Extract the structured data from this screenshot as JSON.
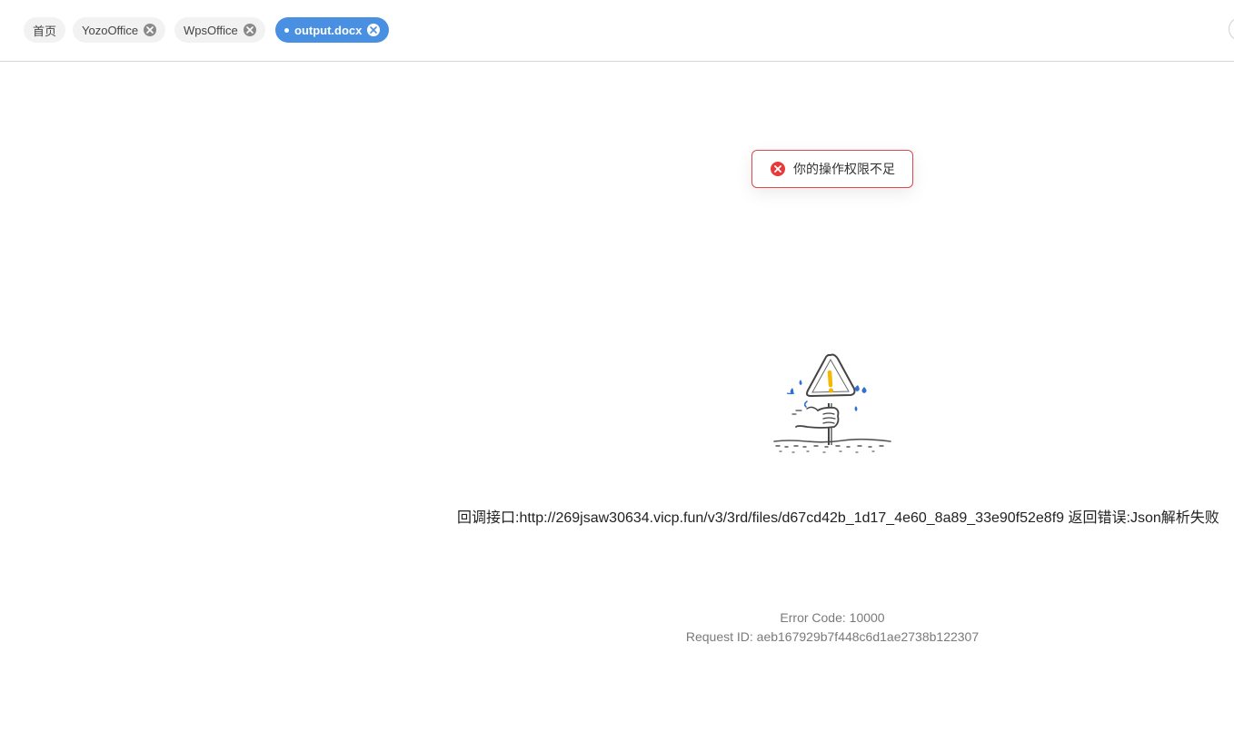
{
  "tabs": [
    {
      "label": "首页",
      "closable": false,
      "active": false
    },
    {
      "label": "YozoOffice",
      "closable": true,
      "active": false
    },
    {
      "label": "WpsOffice",
      "closable": true,
      "active": false
    },
    {
      "label": "output.docx",
      "closable": true,
      "active": true
    }
  ],
  "toast": {
    "type": "error",
    "text": "你的操作权限不足"
  },
  "error": {
    "message": "回调接口:http://269jsaw30634.vicp.fun/v3/3rd/files/d67cd42b_1d17_4e60_8a89_33e90f52e8f9 返回错误:Json解析失败",
    "code_line": "Error Code: 10000",
    "request_line": "Request ID: aeb167929b7f448c6d1ae2738b122307"
  },
  "colors": {
    "accent": "#4a90e2",
    "error": "#e53b3b",
    "warning": "#f5b800"
  }
}
